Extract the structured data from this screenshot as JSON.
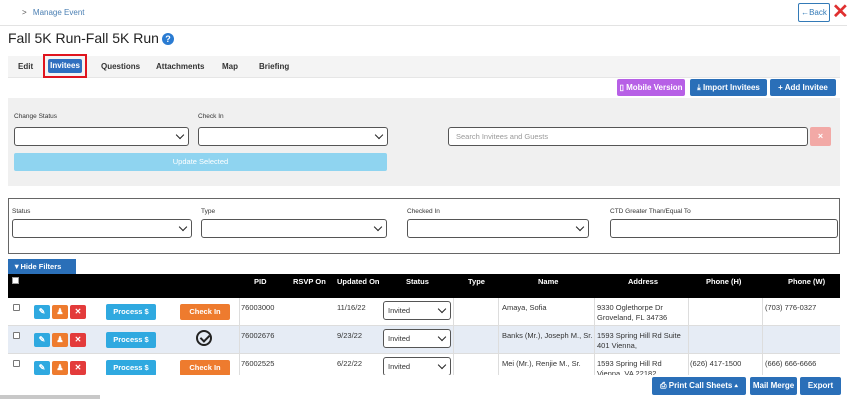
{
  "breadcrumb": {
    "caret": ">",
    "label": "Manage Event"
  },
  "header": {
    "back_label": "←Back",
    "close_icon": "close-icon",
    "title": "Fall 5K Run-Fall 5K Run",
    "help_icon": "question-circle-icon"
  },
  "tabs": [
    {
      "label": "Edit",
      "active": false
    },
    {
      "label": "Invitees",
      "active": true
    },
    {
      "label": "Questions",
      "active": false
    },
    {
      "label": "Attachments",
      "active": false
    },
    {
      "label": "Map",
      "active": false
    },
    {
      "label": "Briefing",
      "active": false
    }
  ],
  "actions": {
    "mobile_label": "Mobile Version",
    "import_label": "Import Invitees",
    "add_label": "Add Invitee"
  },
  "bulk": {
    "change_status_label": "Change Status",
    "check_in_label": "Check In",
    "search_placeholder": "Search Invitees and Guests",
    "clear_label": "×",
    "update_label": "Update Selected"
  },
  "filters": {
    "status_label": "Status",
    "type_label": "Type",
    "checked_in_label": "Checked In",
    "ctd_label": "CTD Greater Than/Equal To",
    "hide_label": "Hide Filters"
  },
  "table": {
    "columns": [
      "PID",
      "RSVP On",
      "Updated On",
      "Status",
      "Type",
      "Name",
      "Address",
      "Phone (H)",
      "Phone (W)"
    ],
    "process_label": "Process $",
    "checkin_label": "Check In",
    "rows": [
      {
        "pid": "76003000",
        "rsvp": "",
        "updated": "11/16/22",
        "status": "Invited",
        "type": "",
        "name": "Amaya, Sofia",
        "address1": "9330 Oglethorpe Dr",
        "address2": "Groveland, FL 34736",
        "phone_h": "",
        "phone_w": "(703) 776-0327",
        "checked_in": false
      },
      {
        "pid": "76002676",
        "rsvp": "",
        "updated": "9/23/22",
        "status": "Invited",
        "type": "",
        "name": "Banks (Mr.), Joseph M., Sr.",
        "address1": "1593 Spring Hill Rd Suite",
        "address2": "401 Vienna,",
        "phone_h": "",
        "phone_w": "",
        "checked_in": true
      },
      {
        "pid": "76002525",
        "rsvp": "",
        "updated": "6/22/22",
        "status": "Invited",
        "type": "",
        "name": "Mei (Mr.), Renjie M., Sr.",
        "address1": "1593 Spring Hill Rd",
        "address2": "Vienna, VA 22182",
        "phone_h": "(626) 417-1500",
        "phone_w": "(666) 666-6666",
        "checked_in": false
      }
    ]
  },
  "footer": {
    "print_label": "Print Call Sheets ▴",
    "mail_label": "Mail Merge",
    "export_label": "Export"
  },
  "colors": {
    "primary": "#2a6fb8",
    "purple": "#b760e6",
    "orange": "#ee7b2e",
    "red": "#e33b3b",
    "cyan": "#2fa9e0",
    "highlight": "#e0141e"
  }
}
